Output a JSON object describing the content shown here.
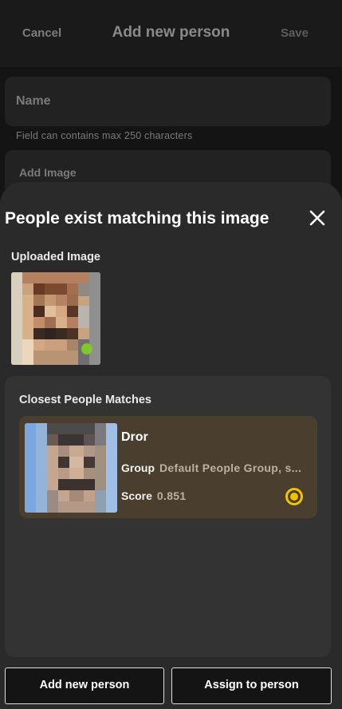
{
  "topbar": {
    "cancel_label": "Cancel",
    "title": "Add new person",
    "save_label": "Save"
  },
  "form": {
    "name_label": "Name",
    "name_helper": "Field can contains max 250 characters",
    "image_label": "Add Image"
  },
  "sheet": {
    "title": "People exist matching this image",
    "uploaded_label": "Uploaded Image",
    "matches_label": "Closest People Matches",
    "matches": [
      {
        "name": "Dror",
        "group_key": "Group",
        "group_value": "Default People Group, s...",
        "score_key": "Score",
        "score_value": "0.851",
        "selected": true
      }
    ]
  },
  "actions": {
    "add_new_label": "Add new person",
    "assign_label": "Assign to person"
  },
  "colors": {
    "accent": "#f2c200",
    "card_bg": "#4a3f2e",
    "status_green": "#7fc72a"
  },
  "icons": {
    "close": "close-icon",
    "radio": "radio-selected-icon"
  }
}
